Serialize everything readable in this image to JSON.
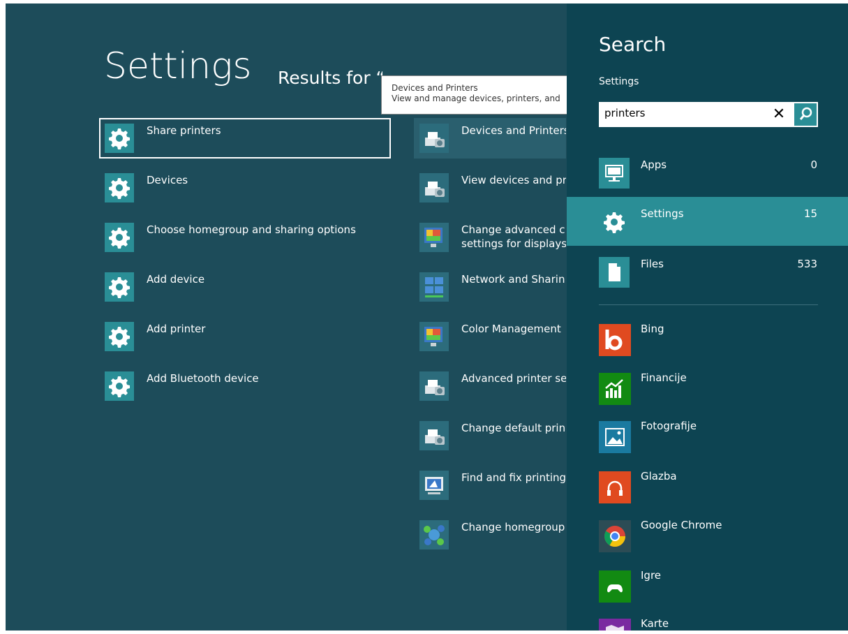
{
  "main": {
    "title": "Settings",
    "results_label": "Results for “printers”"
  },
  "tooltip": {
    "title": "Devices and Printers",
    "description": "View and manage devices, printers, and"
  },
  "results_left": [
    {
      "label": "Share printers",
      "icon": "gear-icon"
    },
    {
      "label": "Devices",
      "icon": "gear-icon"
    },
    {
      "label": "Choose homegroup and sharing options",
      "icon": "gear-icon"
    },
    {
      "label": "Add device",
      "icon": "gear-icon"
    },
    {
      "label": "Add printer",
      "icon": "gear-icon"
    },
    {
      "label": "Add Bluetooth device",
      "icon": "gear-icon"
    }
  ],
  "results_right": [
    {
      "label": "Devices and Printers",
      "icon": "printer-camera-icon"
    },
    {
      "label": "View devices and pr",
      "icon": "printer-camera-icon"
    },
    {
      "label": "Change advanced c",
      "label2": "settings for displays",
      "icon": "display-color-icon"
    },
    {
      "label": "Network and Sharin",
      "icon": "network-icon"
    },
    {
      "label": "Color Management",
      "icon": "display-color-icon"
    },
    {
      "label": "Advanced printer se",
      "icon": "printer-camera-icon"
    },
    {
      "label": "Change default prin",
      "icon": "printer-camera-icon"
    },
    {
      "label": "Find and fix printing",
      "icon": "troubleshoot-icon"
    },
    {
      "label": "Change homegroup",
      "icon": "homegroup-icon"
    }
  ],
  "search": {
    "title": "Search",
    "scope": "Settings",
    "query": "printers",
    "scopes": [
      {
        "label": "Apps",
        "count": "0",
        "icon": "keyboard-monitor-icon"
      },
      {
        "label": "Settings",
        "count": "15",
        "icon": "gear-icon"
      },
      {
        "label": "Files",
        "count": "533",
        "icon": "document-icon"
      }
    ],
    "apps": [
      {
        "label": "Bing",
        "icon": "bing-icon",
        "color": "#e04a20"
      },
      {
        "label": "Financije",
        "icon": "finance-icon",
        "color": "#128a12"
      },
      {
        "label": "Fotografije",
        "icon": "photos-icon",
        "color": "#1a7aa0"
      },
      {
        "label": "Glazba",
        "icon": "headphones-icon",
        "color": "#e04a20"
      },
      {
        "label": "Google Chrome",
        "icon": "chrome-icon",
        "color": "#2c4c55"
      },
      {
        "label": "Igre",
        "icon": "gamepad-icon",
        "color": "#128a12"
      },
      {
        "label": "Karte",
        "icon": "maps-icon",
        "color": "#7a2aa0"
      }
    ]
  },
  "colors": {
    "background": "#1d4c5a",
    "pane": "#0d4452",
    "accent": "#2a8e96"
  }
}
